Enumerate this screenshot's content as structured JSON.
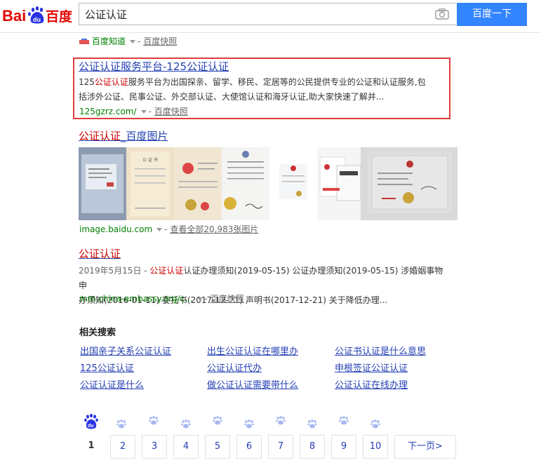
{
  "header": {
    "logo_text": "Bai百度",
    "search_query": "公证认证",
    "search_button_label": "百度一下"
  },
  "top_snippet": {
    "source": "百度知道",
    "cache": "百度快照",
    "sep": "-"
  },
  "results": [
    {
      "title_pre": "",
      "title_em": "公证认证",
      "title_post": "服务平台-125",
      "title_em2": "公证认证",
      "abstract_l1_pre": "125",
      "abstract_l1_em": "公证认证",
      "abstract_l1_post": "服务平台为出国探亲、留学、移民、定居等的公民提供专业的公证和认证服务,包",
      "abstract_l2": "括涉外公证、民事公证、外交部认证、大使馆认证和海牙认证,助大家快速了解并...",
      "url": "125gzrz.com/",
      "cache": "百度快照",
      "sep": "-"
    },
    {
      "title_em": "公证认证",
      "title_post": "_百度图片",
      "url": "image.baidu.com",
      "more": "查看全部20,983张图片",
      "sep": "-"
    },
    {
      "title_em": "公证认证",
      "abstract_l1_pre": "2019年5月15日 - ",
      "abstract_l1_em": "公证认证",
      "abstract_l1_post": "认证办理须知(2019-05-15) 公证办理须知(2019-05-15) 涉婚姻事物申",
      "abstract_l2": "办须知(2016-01-11) 委托书(2017-12-21) 声明书(2017-12-21) 关于降低办理...",
      "url": "mm.china-embassy.org/c...",
      "cache": "百度快照",
      "sep": "-"
    }
  ],
  "related": {
    "title": "相关搜索",
    "links": [
      "出国亲子关系公证认证",
      "出生公证认证在哪里办",
      "公证书认证是什么意思",
      "125公证认证",
      "公证认证代办",
      "申根签证公证认证",
      "公证认证是什么",
      "做公证认证需要带什么",
      "公证认证在线办理"
    ]
  },
  "pagination": {
    "current": "1",
    "pages": [
      "2",
      "3",
      "4",
      "5",
      "6",
      "7",
      "8",
      "9",
      "10"
    ],
    "next": "下一页>",
    "logo_du": "du"
  },
  "colors": {
    "brand_blue": "#3385ff",
    "link_blue": "#2440b3",
    "highlight_red": "#c00",
    "url_green": "#008000",
    "annotation_box": "#e03b3b"
  }
}
